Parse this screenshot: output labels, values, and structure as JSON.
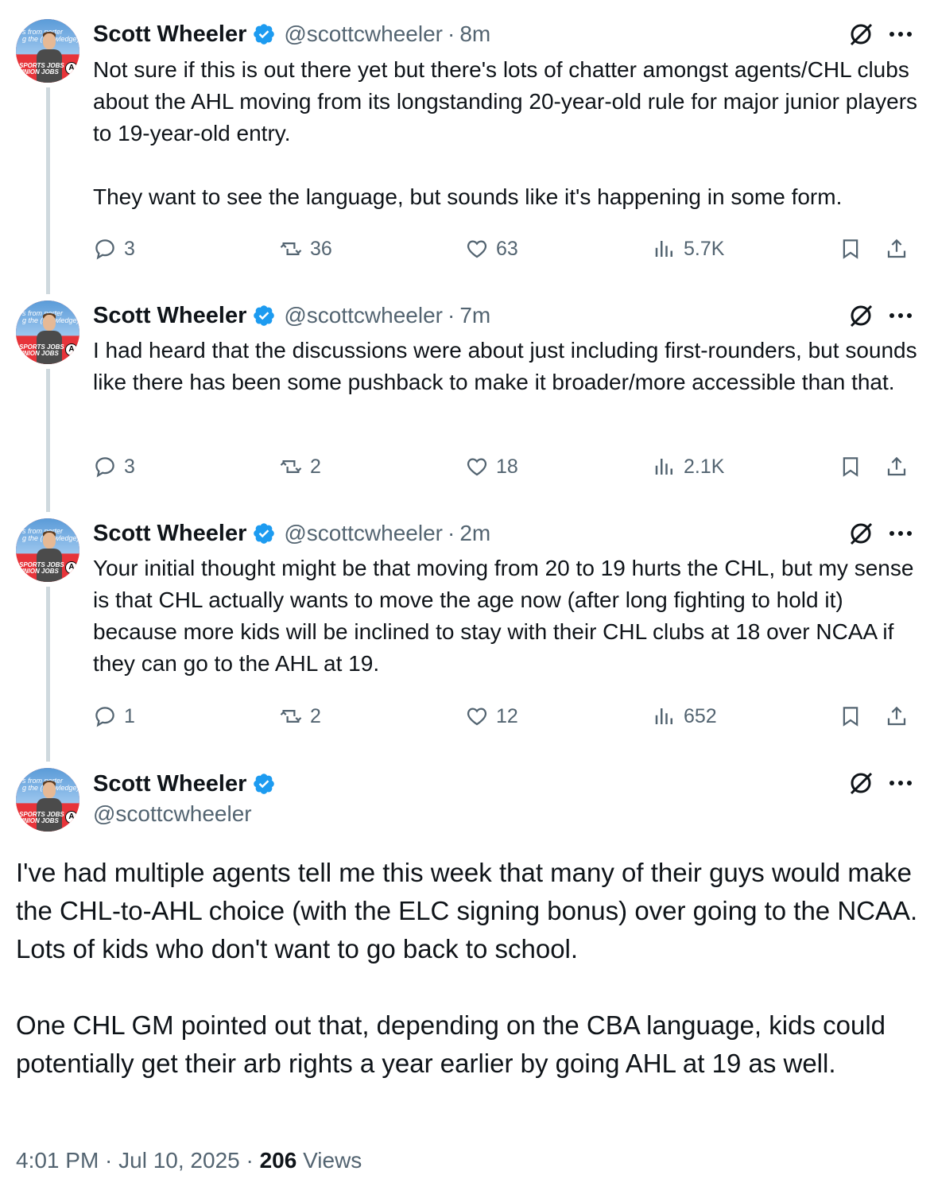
{
  "thread": [
    {
      "name": "Scott Wheeler",
      "handle": "@scottcwheeler",
      "time": "8m",
      "text": "Not sure if this is out there yet but there's lots of chatter amongst agents/CHL clubs about the AHL moving from its longstanding 20-year-old rule for major junior players to 19-year-old entry.\n\nThey want to see the language, but sounds like it's happening in some form.",
      "replies": "3",
      "reposts": "36",
      "likes": "63",
      "views": "5.7K"
    },
    {
      "name": "Scott Wheeler",
      "handle": "@scottcwheeler",
      "time": "7m",
      "text": "I had heard that the discussions were about just including first-rounders, but sounds like there has been some pushback to make it broader/more accessible than that.",
      "replies": "3",
      "reposts": "2",
      "likes": "18",
      "views": "2.1K"
    },
    {
      "name": "Scott Wheeler",
      "handle": "@scottcwheeler",
      "time": "2m",
      "text": "Your initial thought might be that moving from 20 to 19 hurts the CHL, but my sense is that CHL actually wants to move the age now (after long fighting to hold it) because more kids will be inclined to stay with their CHL clubs at 18 over NCAA if they can go to the AHL at 19.",
      "replies": "1",
      "reposts": "2",
      "likes": "12",
      "views": "652"
    }
  ],
  "main": {
    "name": "Scott Wheeler",
    "handle": "@scottcwheeler",
    "text": "I've had multiple agents tell me this week that many of their guys would make the CHL-to-AHL choice (with the ELC signing bonus) over going to the NCAA. Lots of kids who don't want to go back to school.\n\nOne CHL GM pointed out that, depending on the CBA language, kids could potentially get their arb rights a year earlier by going AHL at 19 as well.",
    "timestamp": "4:01 PM · Jul 10, 2025 · ",
    "views_count": "206",
    "views_label": " Views"
  },
  "avatar": {
    "banner_top": "s from porter\ng the (knowledge)",
    "banner_bottom": "SPORTS JOBS\nUNION JOBS",
    "badge": "A"
  },
  "icons": {
    "verified": "verified-badge-icon",
    "grok": "grok-icon",
    "more": "more-icon",
    "reply": "reply-icon",
    "repost": "repost-icon",
    "like": "like-icon",
    "views": "views-icon",
    "bookmark": "bookmark-icon",
    "share": "share-icon"
  },
  "colors": {
    "verified": "#1d9bf0",
    "secondary_text": "#536471",
    "thread_line": "#cfd9de",
    "avatar_red": "#e7343a"
  }
}
